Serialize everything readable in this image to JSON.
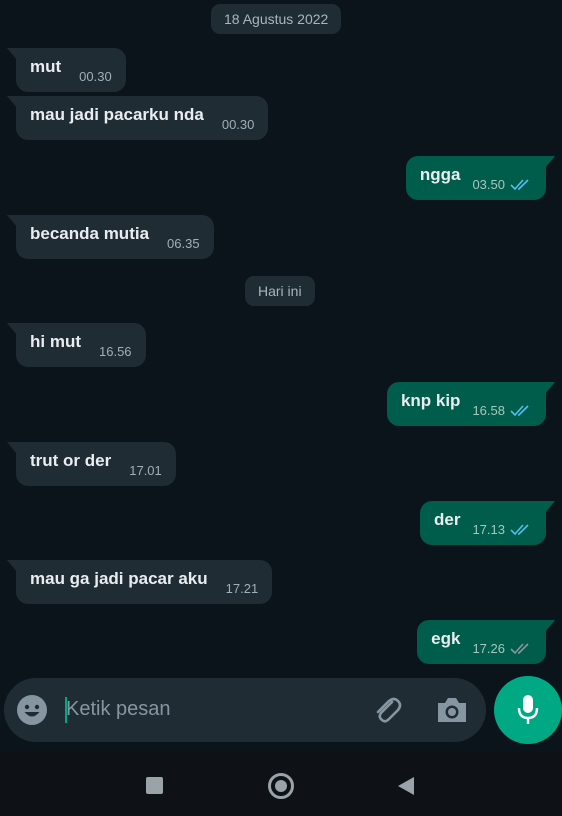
{
  "date_chips": {
    "first": "18 Agustus 2022",
    "today": "Hari ini"
  },
  "messages": [
    {
      "dir": "in",
      "text": "mut",
      "time": "00.30"
    },
    {
      "dir": "in",
      "text": "mau jadi pacarku nda",
      "time": "00.30"
    },
    {
      "dir": "out",
      "text": "ngga",
      "time": "03.50",
      "status": "read"
    },
    {
      "dir": "in",
      "text": "becanda mutia",
      "time": "06.35"
    },
    {
      "dir": "in",
      "text": "hi mut",
      "time": "16.56"
    },
    {
      "dir": "out",
      "text": "knp kip",
      "time": "16.58",
      "status": "read"
    },
    {
      "dir": "in",
      "text": "trut or der",
      "time": "17.01"
    },
    {
      "dir": "out",
      "text": "der",
      "time": "17.13",
      "status": "read"
    },
    {
      "dir": "in",
      "text": "mau ga jadi pacar aku",
      "time": "17.21"
    },
    {
      "dir": "out",
      "text": "egk",
      "time": "17.26",
      "status": "delivered"
    }
  ],
  "composer": {
    "placeholder": "Ketik pesan",
    "emoji_icon": "emoji-icon",
    "attach_icon": "paperclip-icon",
    "camera_icon": "camera-icon",
    "mic_icon": "mic-icon"
  },
  "colors": {
    "background": "#0b141a",
    "incoming_bubble": "#1f2c34",
    "outgoing_bubble": "#005c4b",
    "accent": "#00a884",
    "read_ticks": "#53bdeb",
    "delivered_ticks": "#8696a0"
  },
  "navbar": [
    "recents-square-icon",
    "home-circle-icon",
    "back-triangle-icon"
  ]
}
